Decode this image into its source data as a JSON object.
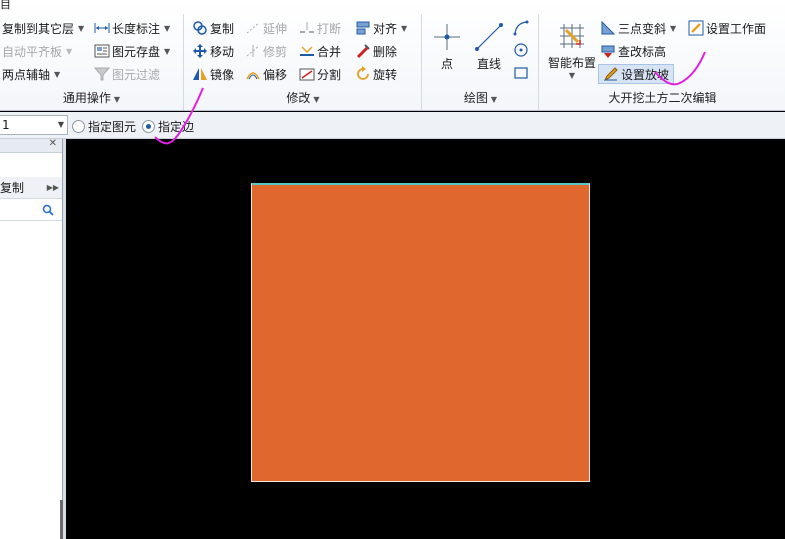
{
  "ribbon": {
    "top_stub": "目",
    "general": {
      "label": "通用操作",
      "copy_to_other_floor": "复制到其它层",
      "auto_align_slab": "自动平齐板",
      "two_point_axis": "两点辅轴",
      "length_dimension": "长度标注",
      "element_storage": "图元存盘",
      "element_filter": "图元过滤"
    },
    "modify": {
      "label": "修改",
      "copy": "复制",
      "move": "移动",
      "mirror": "镜像",
      "extend": "延伸",
      "trim": "修剪",
      "offset": "偏移",
      "break": "打断",
      "merge": "合并",
      "split": "分割",
      "align": "对齐",
      "delete": "删除",
      "rotate": "旋转"
    },
    "draw": {
      "label": "绘图",
      "point": "点",
      "line": "直线"
    },
    "earthwork": {
      "label": "大开挖土方二次编辑",
      "smart_layout": "智能布置",
      "three_point_slope": "三点变斜",
      "modify_elevation": "查改标高",
      "set_slope": "设置放坡",
      "set_working_face": "设置工作面"
    }
  },
  "optbar": {
    "combo_value": "1",
    "radio_element": "指定图元",
    "radio_edge": "指定边"
  },
  "leftpanel": {
    "copy_label": "复制"
  },
  "colors": {
    "region_fill": "#e0672e",
    "region_top_edge": "#57c7c6",
    "canvas_bg": "#000000",
    "annotation": "#e020e0"
  }
}
